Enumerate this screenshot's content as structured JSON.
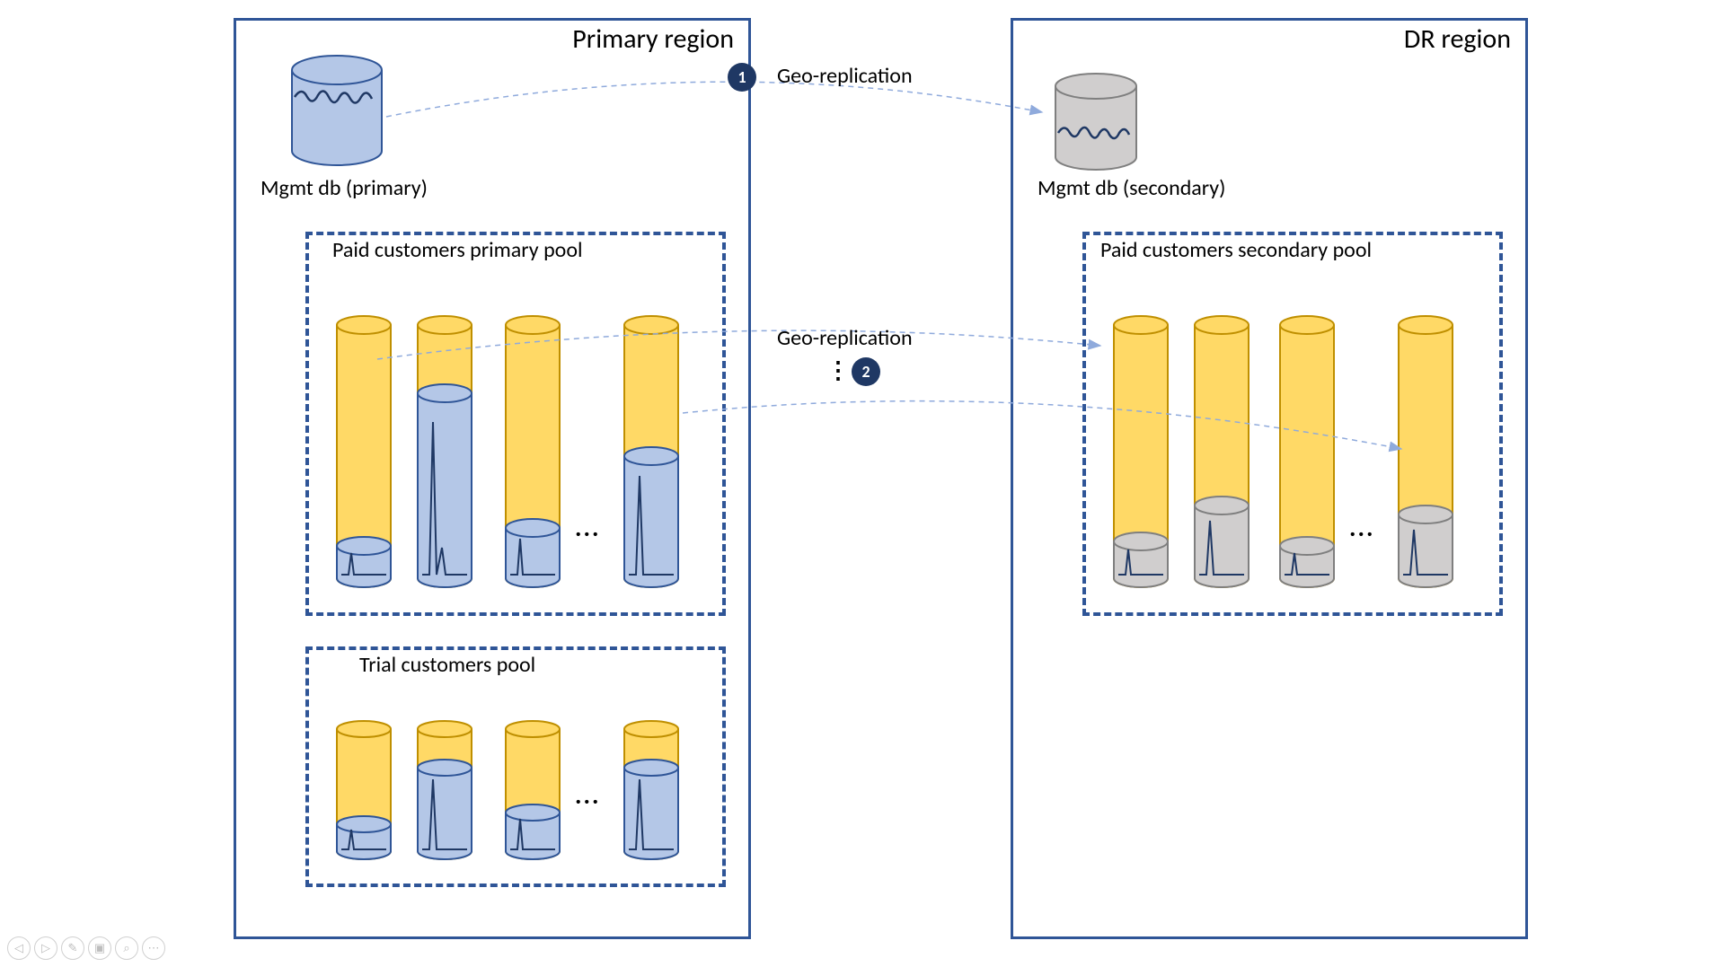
{
  "regions": {
    "primary": {
      "title": "Primary region"
    },
    "dr": {
      "title": "DR region"
    }
  },
  "databases": {
    "mgmt_primary": {
      "label": "Mgmt db (primary)"
    },
    "mgmt_secondary": {
      "label": "Mgmt db (secondary)"
    }
  },
  "pools": {
    "paid_primary": {
      "title": "Paid customers primary pool"
    },
    "paid_secondary": {
      "title": "Paid customers secondary pool"
    },
    "trial": {
      "title": "Trial customers pool"
    }
  },
  "replication": {
    "mgmt_label": "Geo-replication",
    "pool_label": "Geo-replication",
    "badge1": "1",
    "badge2": "2"
  },
  "glyphs": {
    "ellipsis": "...",
    "vdots": "⋮"
  },
  "toolbar": {
    "prev": "◁",
    "next": "▷",
    "pen": "✎",
    "view": "▣",
    "zoom": "⌕",
    "more": "⋯"
  },
  "colors": {
    "border": "#2f5597",
    "badge": "#1f3864",
    "tube_yellow": "#ffd966",
    "tube_yellow_stroke": "#bf8f00",
    "fill_blue": "#b4c7e7",
    "fill_blue_stroke": "#2f5597",
    "fill_grey": "#d0cece",
    "fill_grey_stroke": "#7f7f7f",
    "db_stroke": "#2f5597",
    "spark": "#1f3864",
    "arrow": "#8faadc"
  }
}
